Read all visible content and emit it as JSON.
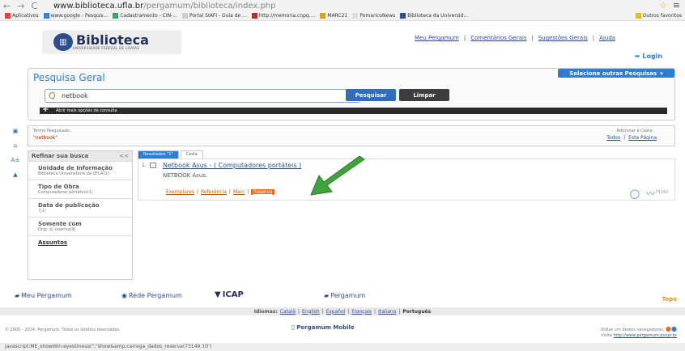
{
  "browser": {
    "url_host": "www.biblioteca.ufla.br",
    "url_path": "/pergamum/biblioteca/index.php",
    "bookmarks": [
      "Aplicativos",
      "www.google - Pesquis...",
      "Cadastramento - CIN-...",
      "Portal SIAFI - Guia de ...",
      "http://memoria.cnpq....",
      "MARC21",
      "PomaricoNews",
      "Biblioteca da Universid..."
    ],
    "others": "Outros favoritos"
  },
  "header": {
    "logo": "Biblioteca",
    "logo_sub": "UNIVERSIDADE FEDERAL DE LAVRAS",
    "links": [
      "Meu Pergamum",
      "Comentários Gerais",
      "Sugestões Gerais",
      "Ajuda"
    ],
    "login": "Login"
  },
  "search": {
    "title": "Pesquisa Geral",
    "other": "Selecione outras Pesquisas",
    "value": "netbook",
    "btn_search": "Pesquisar",
    "btn_clear": "Limpar",
    "more": "Abrir mais opções de consulta"
  },
  "termo": {
    "label": "Termo Pesquisado",
    "value": "\"netbook\"",
    "add_label": "Adicionar à Cesta:",
    "add_links": [
      "Todos",
      "Esta Página"
    ]
  },
  "sidebar": {
    "title": "Refinar sua busca",
    "toggle": "<<",
    "facets": [
      {
        "t": "Unidade de Informação",
        "s": "Biblioteca Universitária da UFLA(1)"
      },
      {
        "t": "Tipo de Obra",
        "s": "Computadores portáteis(1)"
      },
      {
        "t": "Data de publicação",
        "s": "?(1)"
      },
      {
        "t": "Somente com",
        "s": "Disp. p/ reserva(9)"
      },
      {
        "t": "Assuntos",
        "s": ""
      }
    ]
  },
  "results": {
    "tabs": [
      "Resultados \"1\"",
      "Cesta"
    ],
    "item": {
      "num": "1.",
      "title": "Netbook Asus - ( Computadores portáteis )",
      "desc": "NETBOOK Asus.",
      "actions": [
        "Exemplares",
        "Referência",
        "Marc",
        "Reserva"
      ],
      "code": "73149"
    }
  },
  "footer": {
    "logos": [
      "Meu Pergamum",
      "Rede Pergamum",
      "ICAP",
      "Pergamum"
    ],
    "topo": "Topo",
    "idiomas_label": "Idiomas:",
    "languages": [
      "Català",
      "English",
      "Español",
      "Français",
      "Italiano",
      "Português"
    ],
    "copyright": "© 2000 - 2014. Pergamum. Todos os direitos reservados.",
    "mobile": "Pergamum Mobile",
    "nav_note": "Utilize um destes navegadores:",
    "visit": "Visite",
    "visit_link": "http://www.pergamum.pucpr.br",
    "status": "javascript:ME_showWin.eyesOnesa(\",\"show&amp;carrega_dados_reserva(73149,'IO')"
  },
  "colors": {
    "accent": "#2d7ed1",
    "reserva": "#e86a1a",
    "arrow": "#3da53a"
  }
}
